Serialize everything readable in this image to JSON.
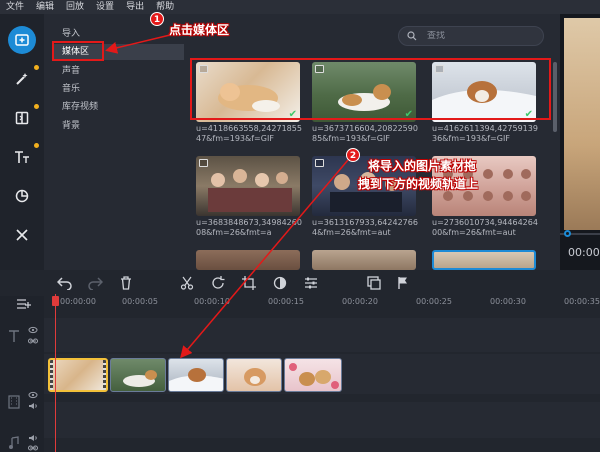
{
  "menu": [
    "文件",
    "编辑",
    "回放",
    "设置",
    "导出",
    "帮助"
  ],
  "tools": [
    {
      "name": "import-media-icon",
      "active": true
    },
    {
      "name": "magic-wand-icon",
      "dot": true
    },
    {
      "name": "transitions-icon",
      "dot": true
    },
    {
      "name": "titles-icon",
      "dot": true
    },
    {
      "name": "stickers-icon",
      "dot": false
    },
    {
      "name": "more-tools-icon",
      "dot": false
    }
  ],
  "categories": [
    "导入",
    "媒体区",
    "声音",
    "音乐",
    "库存视频",
    "背景"
  ],
  "selected_category": "媒体区",
  "search": {
    "placeholder": "查找"
  },
  "media_files": [
    {
      "name": "u=4118663558,2427185547&fm=193&f=GIF"
    },
    {
      "name": "u=3673716604,2082259085&fm=193&f=GIF"
    },
    {
      "name": "u=4162611394,4275913936&fm=193&f=GIF"
    },
    {
      "name": "u=3683848673,3498426008&fm=26&fmt=a"
    },
    {
      "name": "u=3613167933,642427664&fm=26&fmt=aut"
    },
    {
      "name": "u=2736010734,9446426400&fm=26&fmt=aut"
    }
  ],
  "annotations": {
    "step1": {
      "number": "1",
      "text": "点击媒体区"
    },
    "step2": {
      "number": "2",
      "line1": "将导入的图片素材拖",
      "line2": "拽到下方的视频轨道上"
    }
  },
  "preview": {
    "time": "00:00"
  },
  "timeline": {
    "ruler": [
      "00:00:00",
      "00:00:05",
      "00:00:10",
      "00:00:15",
      "00:00:20",
      "00:00:25",
      "00:00:30",
      "00:00:35"
    ],
    "clip_count": 5
  },
  "colors": {
    "accent": "#1d8bd6",
    "annotation": "#e31919",
    "playhead": "#e03b3b",
    "selected_clip": "#f3c13a"
  }
}
